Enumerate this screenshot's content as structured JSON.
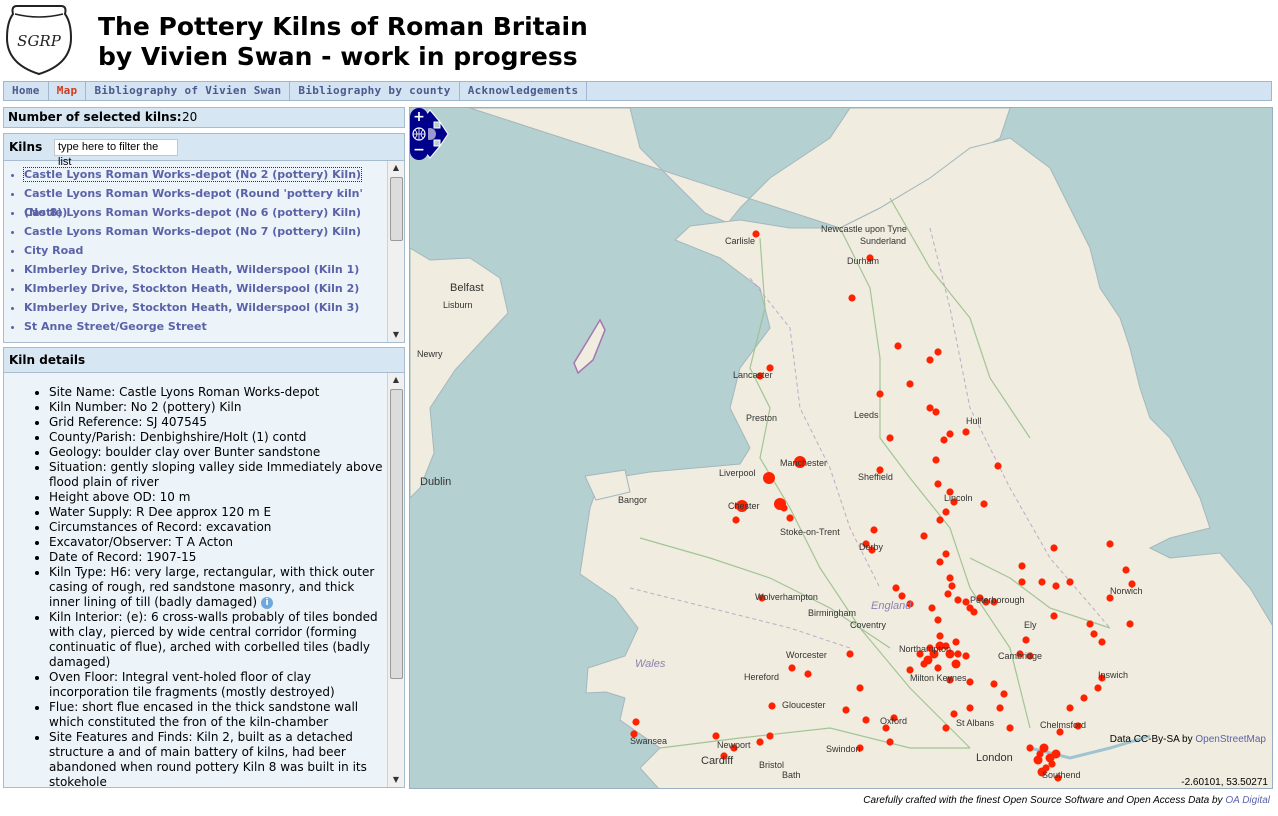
{
  "logo": {
    "text": "SGRP"
  },
  "title": {
    "line1": "The Pottery Kilns of Roman Britain",
    "line2": "by Vivien Swan - work in progress"
  },
  "nav": {
    "items": [
      {
        "label": "Home"
      },
      {
        "label": "Map"
      },
      {
        "label": "Bibliography of Vivien Swan"
      },
      {
        "label": "Bibliography by county"
      },
      {
        "label": "Acknowledgements"
      }
    ],
    "active": "Map"
  },
  "selection": {
    "label": "Number of selected kilns:",
    "count": "20"
  },
  "kilns": {
    "label": "Kilns",
    "filter_placeholder": "type here to filter the list",
    "items": [
      "Castle Lyons Roman Works-depot (No 2 (pottery) Kiln)",
      "Castle Lyons Roman Works-depot (Round 'pottery kiln' (No 8))",
      "Castle Lyons Roman Works-depot (No 6 (pottery) Kiln)",
      "Castle Lyons Roman Works-depot (No 7 (pottery) Kiln)",
      "City Road",
      "KImberley Drive, Stockton Heath, Wilderspool (Kiln 1)",
      "KImberley Drive, Stockton Heath, Wilderspool (Kiln 2)",
      "KImberley Drive, Stockton Heath, Wilderspool (Kiln 3)",
      "St Anne Street/George Street"
    ]
  },
  "details": {
    "label": "Kiln details",
    "fields": [
      "Site Name: Castle Lyons Roman Works-depot",
      "Kiln Number: No 2 (pottery) Kiln",
      "Grid Reference: SJ 407545",
      "County/Parish: Denbighshire/Holt (1) contd",
      "Geology: boulder clay over Bunter sandstone",
      "Situation: gently sloping valley side Immediately above flood plain of river",
      "Height above OD: 10 m",
      "Water Supply: R Dee approx 120 m E",
      "Circumstances of Record: excavation",
      "Excavator/Observer: T A Acton",
      "Date of Record: 1907-15",
      "Kiln Type: H6: very large, rectangular, with thick outer casing of rough, red sandstone masonry, and thick inner lining of till (badly damaged)",
      "Kiln Interior: (e): 6 cross-walls probably of tiles bonded with clay, pierced by wide central corridor (forming continuatic of flue), arched with corbelled tiles (badly damaged)",
      "Oven Floor: Integral vent-holed floor of clay incorporation tile fragments (mostly destroyed)",
      "Flue: short flue encased in the thick sandstone wall which constituted the fron of the kiln-chamber",
      "Site Features and Finds: Kiln 2, built as a detached structure a and of main battery of kilns, had beer abandoned when round pottery Kiln 8 was built in its stokehole"
    ]
  },
  "map": {
    "labels": {
      "carlisle": "Carlisle",
      "newcastle": "Newcastle upon Tyne",
      "sunderland": "Sunderland",
      "durham": "Durham",
      "belfast": "Belfast",
      "lisburn": "Lisburn",
      "newry": "Newry",
      "lancaster": "Lancaster",
      "leeds": "Leeds",
      "hull": "Hull",
      "preston": "Preston",
      "manchester": "Manchester",
      "liverpool": "Liverpool",
      "sheffield": "Sheffield",
      "dublin": "Dublin",
      "bangor": "Bangor",
      "chester": "Chester",
      "lincoln": "Lincoln",
      "stoke": "Stoke-on-Trent",
      "derby": "Derby",
      "nottingham": "Nottingham",
      "norwich": "Norwich",
      "wolverhampton": "Wolverhampton",
      "birmingham": "Birmingham",
      "peterborough": "Peterborough",
      "england": "England",
      "coventry": "Coventry",
      "ely": "Ely",
      "wales": "Wales",
      "worcester": "Worcester",
      "northampton": "Northampton",
      "cambridge": "Cambridge",
      "hereford": "Hereford",
      "milton_keynes": "Milton Keynes",
      "ipswich": "Ipswich",
      "gloucester": "Gloucester",
      "oxford": "Oxford",
      "stalbans": "St Albans",
      "chelmsford": "Chelmsford",
      "swansea": "Swansea",
      "newport": "Newport",
      "swindon": "Swindon",
      "cardiff": "Cardiff",
      "bristol": "Bristol",
      "london": "London",
      "bath": "Bath",
      "southend": "Southend"
    },
    "attribution_prefix": "Data CC-By-SA by",
    "attribution_link": "OpenStreetMap",
    "coords": "-2.60101, 53.50271",
    "marker_color": "#ff2200"
  },
  "footer": {
    "text": "Carefully crafted with the finest Open Source Software and Open Access Data by",
    "link": "OA Digital"
  }
}
